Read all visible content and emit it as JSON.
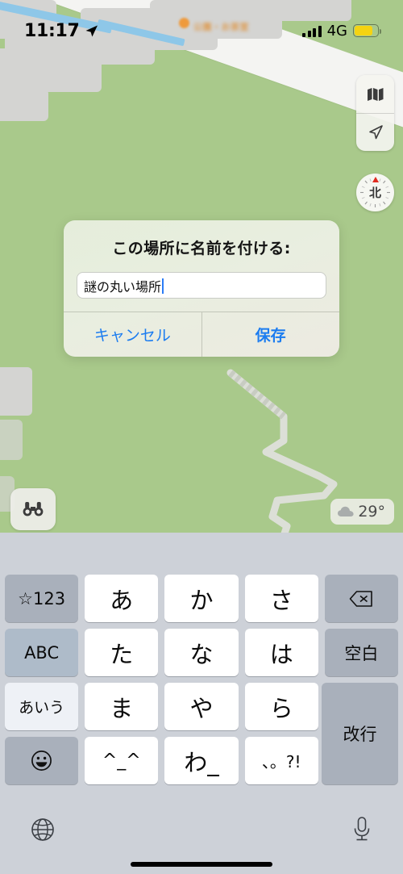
{
  "status_bar": {
    "time": "11:17",
    "location_icon": "location-arrow-icon",
    "signal_icon": "cellular-signal-icon",
    "network": "4G",
    "battery_icon": "battery-low-power-icon"
  },
  "map": {
    "controls": {
      "layers_icon": "map-layers-icon",
      "locate_icon": "navigation-arrow-icon",
      "compass_label": "北",
      "binoculars_icon": "binoculars-icon"
    },
    "weather": {
      "icon": "cloud-icon",
      "temperature": "29°"
    },
    "poi_label": "公園・お茶室",
    "colors": {
      "park_green": "#a9c98b",
      "road_white": "#f4f4f2",
      "building_gray": "#d4d4d2",
      "water_blue": "#8ec7e8",
      "trail_gray": "#d8dad3"
    }
  },
  "dialog": {
    "title": "この場所に名前を付ける:",
    "input_value": "謎の丸い場所",
    "input_placeholder": "",
    "cancel_label": "キャンセル",
    "save_label": "保存",
    "accent_color": "#1b7cf0"
  },
  "keyboard": {
    "type": "japanese-kana-10key",
    "rows": [
      [
        {
          "name": "key-symbols",
          "label": "☆123",
          "style": "func"
        },
        {
          "name": "key-a",
          "label": "あ",
          "style": "kana"
        },
        {
          "name": "key-ka",
          "label": "か",
          "style": "kana"
        },
        {
          "name": "key-sa",
          "label": "さ",
          "style": "kana"
        },
        {
          "name": "key-delete",
          "label": "delete-icon",
          "style": "func"
        }
      ],
      [
        {
          "name": "key-abc",
          "label": "ABC",
          "style": "func-light"
        },
        {
          "name": "key-ta",
          "label": "た",
          "style": "kana"
        },
        {
          "name": "key-na",
          "label": "な",
          "style": "kana"
        },
        {
          "name": "key-ha",
          "label": "は",
          "style": "kana"
        },
        {
          "name": "key-space",
          "label": "空白",
          "style": "func"
        }
      ],
      [
        {
          "name": "key-aiu",
          "label": "あいう",
          "style": "func-white"
        },
        {
          "name": "key-ma",
          "label": "ま",
          "style": "kana"
        },
        {
          "name": "key-ya",
          "label": "や",
          "style": "kana"
        },
        {
          "name": "key-ra",
          "label": "ら",
          "style": "kana"
        },
        {
          "name": "key-return",
          "label": "改行",
          "style": "func"
        }
      ],
      [
        {
          "name": "key-emoji",
          "label": "emoji-smiley-icon",
          "style": "func"
        },
        {
          "name": "key-kaomoji",
          "label": "^_^",
          "style": "kana"
        },
        {
          "name": "key-wa",
          "label": "わ_",
          "style": "kana"
        },
        {
          "name": "key-punctuation",
          "label": "、。?!",
          "style": "kana"
        }
      ]
    ],
    "bottom_bar": {
      "globe_icon": "globe-icon",
      "mic_icon": "microphone-icon",
      "home_indicator": "home-indicator"
    }
  }
}
